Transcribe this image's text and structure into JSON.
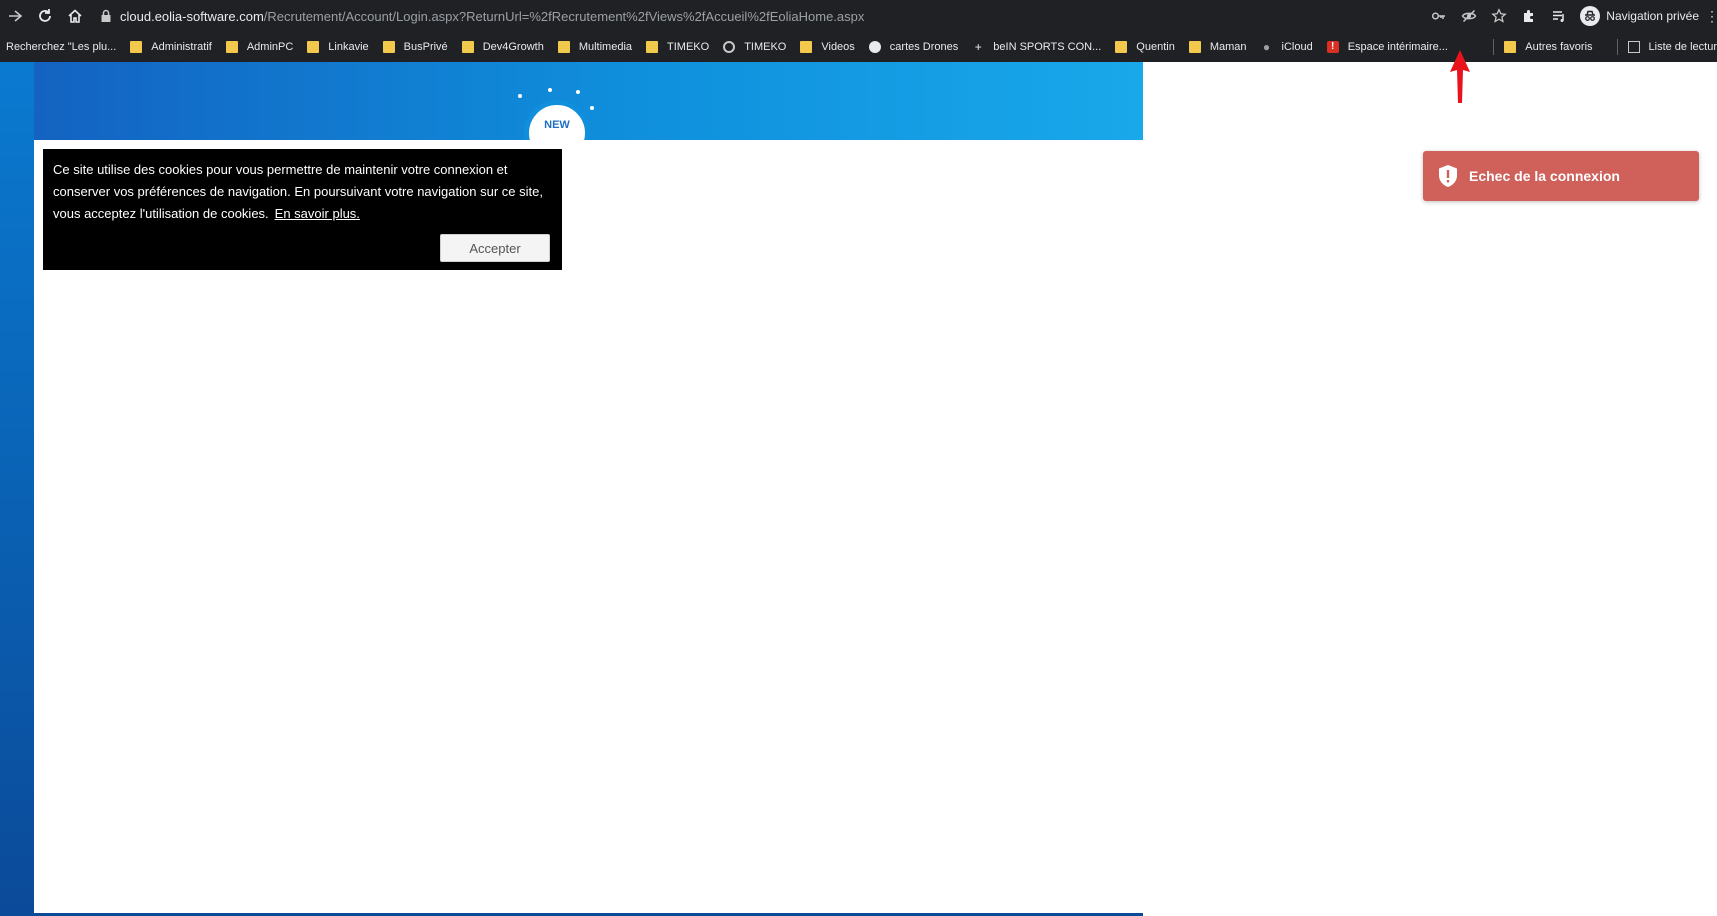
{
  "browser": {
    "url_domain": "cloud.eolia-software.com",
    "url_path": "/Recrutement/Account/Login.aspx?ReturnUrl=%2fRecrutement%2fViews%2fAccueil%2fEoliaHome.aspx",
    "profile_label": "Navigation privée",
    "icons": [
      "back-arrow-icon",
      "reload-icon",
      "home-icon",
      "lock-icon",
      "key-icon",
      "eye-off-icon",
      "star-icon",
      "puzzle-icon",
      "reading-list-icon",
      "incognito-icon",
      "menu-icon"
    ]
  },
  "bookmarks": {
    "items": [
      {
        "label": "Recherchez \"Les plu...",
        "icon": "none"
      },
      {
        "label": "Administratif",
        "icon": "folder"
      },
      {
        "label": "AdminPC",
        "icon": "folder"
      },
      {
        "label": "Linkavie",
        "icon": "folder"
      },
      {
        "label": "BusPrivé",
        "icon": "folder"
      },
      {
        "label": "Dev4Growth",
        "icon": "folder"
      },
      {
        "label": "Multimedia",
        "icon": "folder"
      },
      {
        "label": "TIMEKO",
        "icon": "folder"
      },
      {
        "label": "TIMEKO",
        "icon": "clock"
      },
      {
        "label": "Videos",
        "icon": "folder"
      },
      {
        "label": "cartes Drones",
        "icon": "globe"
      },
      {
        "label": "beIN SPORTS CON...",
        "icon": "plus"
      },
      {
        "label": "Quentin",
        "icon": "folder"
      },
      {
        "label": "Maman",
        "icon": "folder"
      },
      {
        "label": "iCloud",
        "icon": "apple"
      },
      {
        "label": "Espace intérimaire...",
        "icon": "alert"
      }
    ],
    "other_favorites": "Autres favoris",
    "reading_list": "Liste de lectur"
  },
  "page": {
    "badge_text": "NEW",
    "cookie_text": "Ce site utilise des cookies pour vous permettre de maintenir votre connexion et conserver vos préférences de navigation. En poursuivant votre navigation sur ce site, vous acceptez l'utilisation de cookies.",
    "cookie_link": "En savoir plus.",
    "accept_label": "Accepter"
  },
  "toast": {
    "message": "Echec de la connexion",
    "color": "#cf605a"
  },
  "colors": {
    "chrome": "#202124",
    "hero_start": "#1460c0",
    "hero_end": "#19a8ea",
    "annotation_arrow": "#e8131b"
  }
}
